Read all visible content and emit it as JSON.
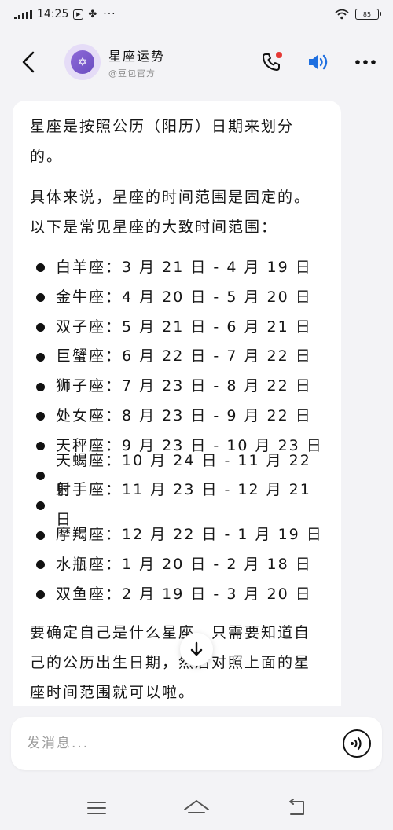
{
  "status_bar": {
    "time": "14:25",
    "more": "···",
    "battery": "85"
  },
  "header": {
    "bot_name": "星座运势",
    "bot_sub": "@豆包官方",
    "avatar_glyph": "✡",
    "icons": [
      "back-icon",
      "phone-icon",
      "speaker-icon",
      "more-icon"
    ],
    "call_badge_color": "#e53935",
    "speaker_color": "#1e6fe0"
  },
  "message": {
    "intro": "星座是按照公历（阳历）日期来划分的。",
    "lead": "具体来说，星座的时间范围是固定的。以下是常见星座的大致时间范围：",
    "signs": [
      "白羊座：3 月 21 日 - 4 月 19 日",
      "金牛座：4 月 20 日 - 5 月 20 日",
      "双子座：5 月 21 日 - 6 月 21 日",
      "巨蟹座：6 月 22 日 - 7 月 22 日",
      "狮子座：7 月 23 日 - 8 月 22 日",
      "处女座：8 月 23 日 - 9 月 22 日",
      "天秤座：9 月 23 日 - 10 月 23 日",
      "天蝎座：10 月 24 日 - 11 月 22 日",
      "射手座：11 月 23 日 - 12 月 21 日",
      "摩羯座：12 月 22 日 - 1 月 19 日",
      "水瓶座：1 月 20 日 - 2 月 18 日",
      "双鱼座：2 月 19 日 - 3 月 20 日"
    ],
    "closing": "要确定自己是什么星座，只需要知道自己的公历出生日期，然后对照上面的星座时间范围就可以啦。"
  },
  "input": {
    "placeholder": "发消息..."
  }
}
